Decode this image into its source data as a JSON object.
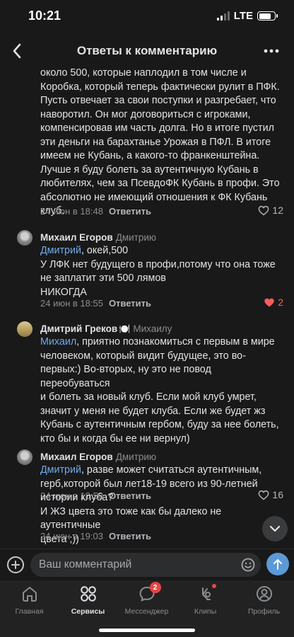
{
  "status_bar": {
    "time": "10:21",
    "network": "LTE",
    "battery_level": 0.8
  },
  "header": {
    "title": "Ответы к комментарию",
    "back_icon": "chevron-left-icon",
    "more_icon": "more-horizontal-icon"
  },
  "comments": [
    {
      "text_lines": [
        "около 500, которые наплодил в том числе и",
        "Коробка, который теперь фактически рулит в ПФК.",
        "Пусть отвечает за свои поступки и разгребает, что",
        "наворотил. Он мог договориться с игроками,",
        "компенсировав им часть долга. Но в итоге пустил",
        "эти деньги на барахтанье Урожая в ПФЛ. В итоге",
        "имеем не Кубань, а какого-то франкенштейна.",
        "Лучше я буду болеть за аутентичную Кубань в",
        "любителях, чем за ПсевдоФК Кубань в профи. Это",
        "абсолютно не имеющий отношения к ФК Кубань",
        "клуб."
      ],
      "date": "24 июн в 18:48",
      "reply_label": "Ответить",
      "likes": "12",
      "liked": false
    },
    {
      "author": "Михаил Егоров",
      "reply_to": "Дмитрию",
      "mention": "Дмитрий",
      "first_line_rest": ", окей,500",
      "text_lines": [
        "У ЛФК нет будущего в профи,потому что она тоже",
        "не заплатит эти 500 лямов",
        "НИКОГДА"
      ],
      "date": "24 июн в 18:55",
      "reply_label": "Ответить",
      "likes": "2",
      "liked": true
    },
    {
      "author": "Дмитрий Греков",
      "author_emoji": "🍽️",
      "reply_to": "Михаилу",
      "mention": "Михаил",
      "first_line_rest": ", приятно познакомиться с первым в мире",
      "text_lines": [
        "человеком, который видит будущее, это во-",
        "первых:) Во-вторых, ну это не повод переобуваться",
        "и болеть за новый клуб. Если мой клуб умрет,",
        "значит у меня не будет клуба. Если же будет жз",
        "Кубань с аутентичным гербом, буду за нее болеть,",
        "кто бы и когда бы ее ни вернул)"
      ],
      "date": "24 июн в 18:58",
      "reply_label": "Ответить",
      "likes": "16",
      "liked": false
    },
    {
      "author": "Михаил Егоров",
      "reply_to": "Дмитрию",
      "mention": "Дмитрий",
      "first_line_rest": ", разве может считаться аутентичным,",
      "text_lines": [
        "герб,которой был лет18-19 всего из 90-летней",
        "истории клуба?",
        "И ЖЗ цвета это тоже как бы далеко не аутентичные",
        "цвета ;))"
      ],
      "date": "24 июн в 19:03",
      "reply_label": "Ответить"
    }
  ],
  "composer": {
    "placeholder": "Ваш комментарий"
  },
  "tabs": [
    {
      "label": "Главная",
      "icon": "home-icon",
      "active": false
    },
    {
      "label": "Сервисы",
      "icon": "services-icon",
      "active": true
    },
    {
      "label": "Мессенджер",
      "icon": "messenger-icon",
      "badge": "2",
      "active": false
    },
    {
      "label": "Клипы",
      "icon": "clips-icon",
      "active": false
    },
    {
      "label": "Профиль",
      "icon": "profile-icon",
      "active": false
    }
  ],
  "colors": {
    "background": "#191919",
    "link": "#71aaeb",
    "like_active": "#ff5c5c",
    "send_button": "#5b9ad6",
    "badge": "#e64646"
  }
}
